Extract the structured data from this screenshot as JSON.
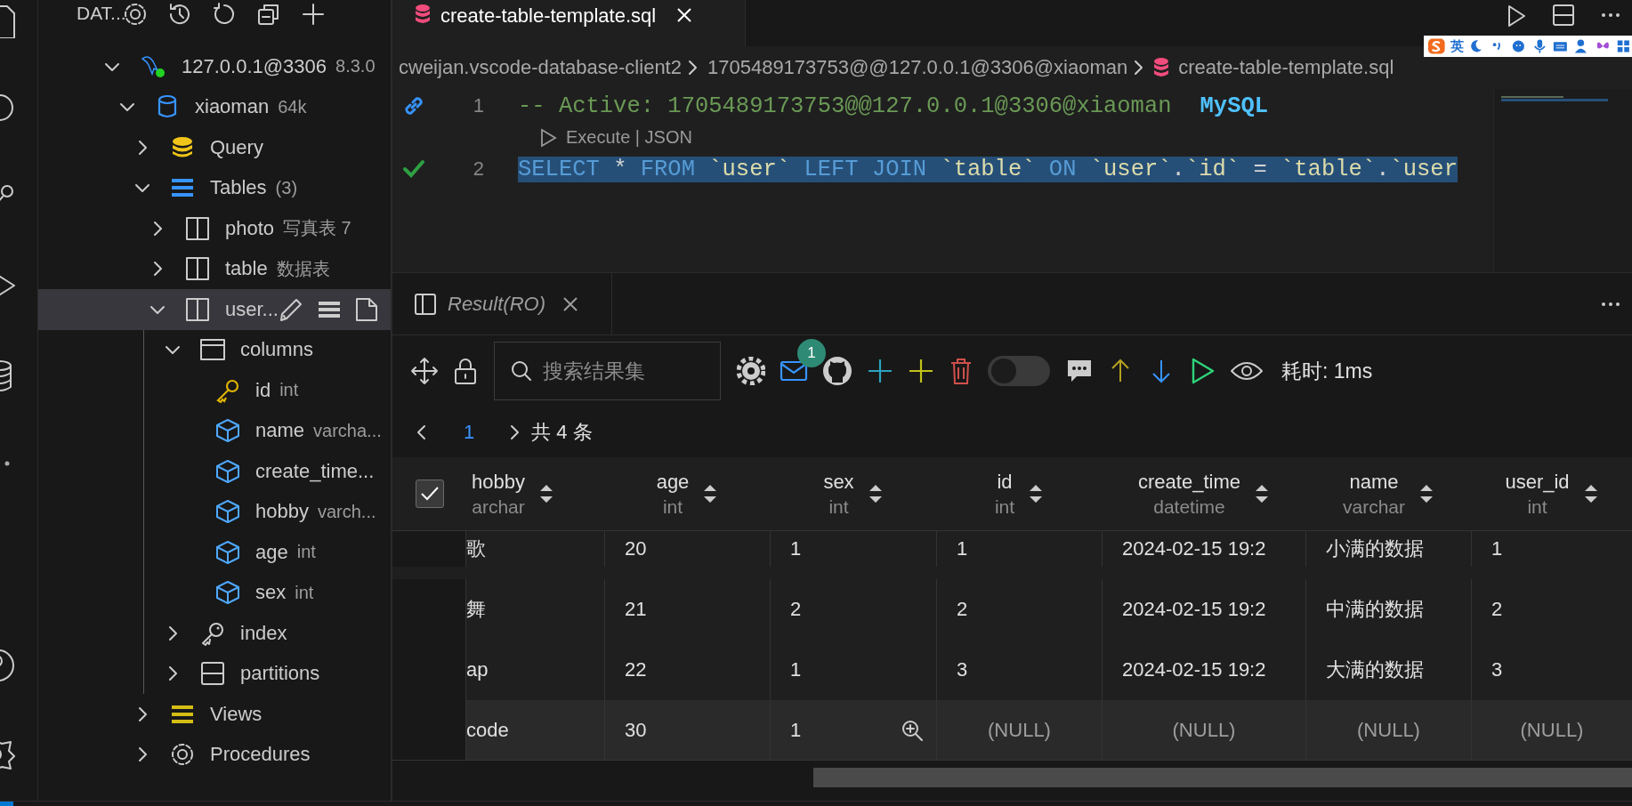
{
  "sidebar": {
    "title": "DAT...",
    "tree": [
      {
        "label": "127.0.0.1@3306",
        "detail": "8.3.0",
        "kind": "connection",
        "connected": true,
        "expanded": true,
        "selected": false,
        "children": [
          {
            "label": "xiaoman",
            "detail": "64k",
            "kind": "database",
            "expanded": true,
            "selected": false,
            "children": [
              {
                "label": "Query",
                "kind": "query",
                "expanded": false,
                "selected": false
              },
              {
                "label": "Tables",
                "detail": "(3)",
                "kind": "tables",
                "expanded": true,
                "selected": false,
                "children": [
                  {
                    "label": "photo",
                    "detail": "写真表 7",
                    "kind": "table",
                    "expanded": false,
                    "selected": false
                  },
                  {
                    "label": "table",
                    "detail": "数据表",
                    "kind": "table",
                    "expanded": false,
                    "selected": false
                  },
                  {
                    "label": "user...",
                    "kind": "table",
                    "expanded": true,
                    "selected": true,
                    "children": [
                      {
                        "label": "columns",
                        "kind": "columns",
                        "expanded": true,
                        "selected": false,
                        "children": [
                          {
                            "label": "id",
                            "detail": "int",
                            "kind": "key",
                            "selected": false
                          },
                          {
                            "label": "name",
                            "detail": "varcha...",
                            "kind": "column",
                            "selected": false
                          },
                          {
                            "label": "create_time...",
                            "kind": "column",
                            "selected": false
                          },
                          {
                            "label": "hobby",
                            "detail": "varch...",
                            "kind": "column",
                            "selected": false
                          },
                          {
                            "label": "age",
                            "detail": "int",
                            "kind": "column",
                            "selected": false
                          },
                          {
                            "label": "sex",
                            "detail": "int",
                            "kind": "column",
                            "selected": false
                          }
                        ]
                      },
                      {
                        "label": "index",
                        "kind": "index",
                        "expanded": false,
                        "selected": false
                      },
                      {
                        "label": "partitions",
                        "kind": "partitions",
                        "expanded": false,
                        "selected": false
                      }
                    ]
                  }
                ]
              },
              {
                "label": "Views",
                "kind": "views",
                "expanded": false,
                "selected": false
              },
              {
                "label": "Procedures",
                "kind": "procedures",
                "expanded": false,
                "selected": false
              }
            ]
          }
        ]
      }
    ]
  },
  "editor": {
    "tabs": [
      {
        "label": "create-table-template.sql",
        "selected": true
      }
    ],
    "breadcrumbs": [
      "cweijan.vscode-database-client2",
      "1705489173753@@127.0.0.1@3306@xiaoman",
      "create-table-template.sql"
    ],
    "ime": {
      "mode": "英"
    },
    "lines": [
      {
        "number": "1",
        "kind": "link",
        "selected": false,
        "tokens": [
          {
            "text": "-- Active: 1705489173753@@127.0.0.1@3306@xiaoman",
            "kind": "comment"
          },
          {
            "text": "MySQL",
            "kind": "dialect"
          }
        ],
        "codelens": "Execute | JSON"
      },
      {
        "number": "2",
        "kind": "check",
        "selected": true,
        "tokens": [
          {
            "text": "SELECT ",
            "kind": "keyword"
          },
          {
            "text": "* ",
            "kind": "op"
          },
          {
            "text": "FROM ",
            "kind": "keyword"
          },
          {
            "text": "`user` ",
            "kind": "ident"
          },
          {
            "text": "LEFT JOIN ",
            "kind": "keyword"
          },
          {
            "text": "`table` ",
            "kind": "ident"
          },
          {
            "text": "ON ",
            "kind": "keyword"
          },
          {
            "text": "`user`",
            "kind": "ident"
          },
          {
            "text": ".",
            "kind": "op"
          },
          {
            "text": "`id` ",
            "kind": "ident"
          },
          {
            "text": "= ",
            "kind": "op"
          },
          {
            "text": "`table`",
            "kind": "ident"
          },
          {
            "text": ".",
            "kind": "op"
          },
          {
            "text": "`user",
            "kind": "ident"
          }
        ]
      }
    ]
  },
  "panel": {
    "tabs": [
      {
        "label": "Result(RO)",
        "selected": true
      }
    ],
    "search": {
      "placeholder": "搜索结果集"
    },
    "mail_badge": "1",
    "toggle": {
      "on": false
    },
    "elapsed": "耗时: 1ms",
    "pagination": {
      "page": "1",
      "total": "共 4 条"
    },
    "table": {
      "select_all": {
        "checked": true
      },
      "columns": [
        {
          "name": "hobby",
          "type": "archar"
        },
        {
          "name": "age",
          "type": "int"
        },
        {
          "name": "sex",
          "type": "int"
        },
        {
          "name": "id",
          "type": "int"
        },
        {
          "name": "create_time",
          "type": "datetime"
        },
        {
          "name": "name",
          "type": "varchar"
        },
        {
          "name": "user_id",
          "type": "int"
        }
      ],
      "rows": [
        {
          "hovered": false,
          "cells": [
            {
              "text": "歌",
              "null": false
            },
            {
              "text": "20",
              "null": false
            },
            {
              "text": "1",
              "null": false
            },
            {
              "text": "1",
              "null": false
            },
            {
              "text": "2024-02-15 19:2",
              "null": false
            },
            {
              "text": "小满的数据",
              "null": false
            },
            {
              "text": "1",
              "null": false
            }
          ]
        },
        {
          "hovered": false,
          "cells": [
            {
              "text": "舞",
              "null": false
            },
            {
              "text": "21",
              "null": false
            },
            {
              "text": "2",
              "null": false
            },
            {
              "text": "2",
              "null": false
            },
            {
              "text": "2024-02-15 19:2",
              "null": false
            },
            {
              "text": "中满的数据",
              "null": false
            },
            {
              "text": "2",
              "null": false
            }
          ]
        },
        {
          "hovered": false,
          "cells": [
            {
              "text": "ap",
              "null": false
            },
            {
              "text": "22",
              "null": false
            },
            {
              "text": "1",
              "null": false
            },
            {
              "text": "3",
              "null": false
            },
            {
              "text": "2024-02-15 19:2",
              "null": false
            },
            {
              "text": "大满的数据",
              "null": false
            },
            {
              "text": "3",
              "null": false
            }
          ]
        },
        {
          "hovered": true,
          "cells": [
            {
              "text": "code",
              "null": false
            },
            {
              "text": "30",
              "null": false
            },
            {
              "text": "1",
              "null": false
            },
            {
              "text": "(NULL)",
              "null": true
            },
            {
              "text": "(NULL)",
              "null": true
            },
            {
              "text": "(NULL)",
              "null": true
            },
            {
              "text": "(NULL)",
              "null": true
            }
          ]
        }
      ]
    }
  }
}
